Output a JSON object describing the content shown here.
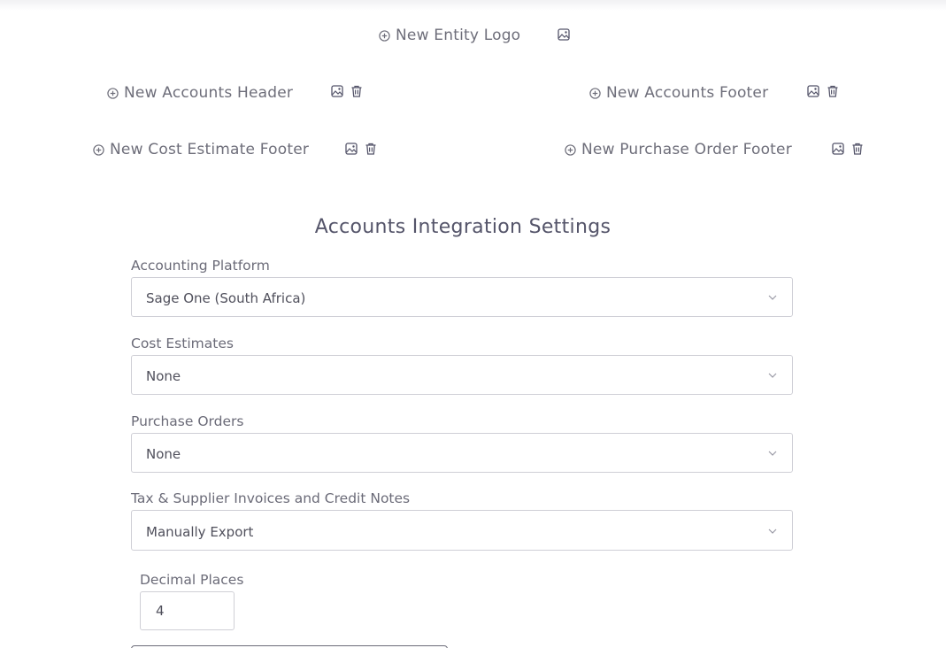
{
  "uploads": {
    "entity_logo": "New Entity Logo",
    "accounts_header": "New Accounts Header",
    "accounts_footer": "New Accounts Footer",
    "cost_estimate_footer": "New Cost Estimate Footer",
    "purchase_order_footer": "New Purchase Order Footer"
  },
  "settings": {
    "title": "Accounts Integration Settings",
    "accounting_platform": {
      "label": "Accounting Platform",
      "value": "Sage One (South Africa)"
    },
    "cost_estimates": {
      "label": "Cost Estimates",
      "value": "None"
    },
    "purchase_orders": {
      "label": "Purchase Orders",
      "value": "None"
    },
    "tax_supplier": {
      "label": "Tax & Supplier Invoices and Credit Notes",
      "value": "Manually Export"
    },
    "decimal_places": {
      "label": "Decimal Places",
      "value": "4"
    }
  },
  "icons": {
    "add": "plus-circle-icon",
    "image": "image-icon",
    "delete": "trash-icon",
    "dropdown": "chevron-down-icon"
  }
}
